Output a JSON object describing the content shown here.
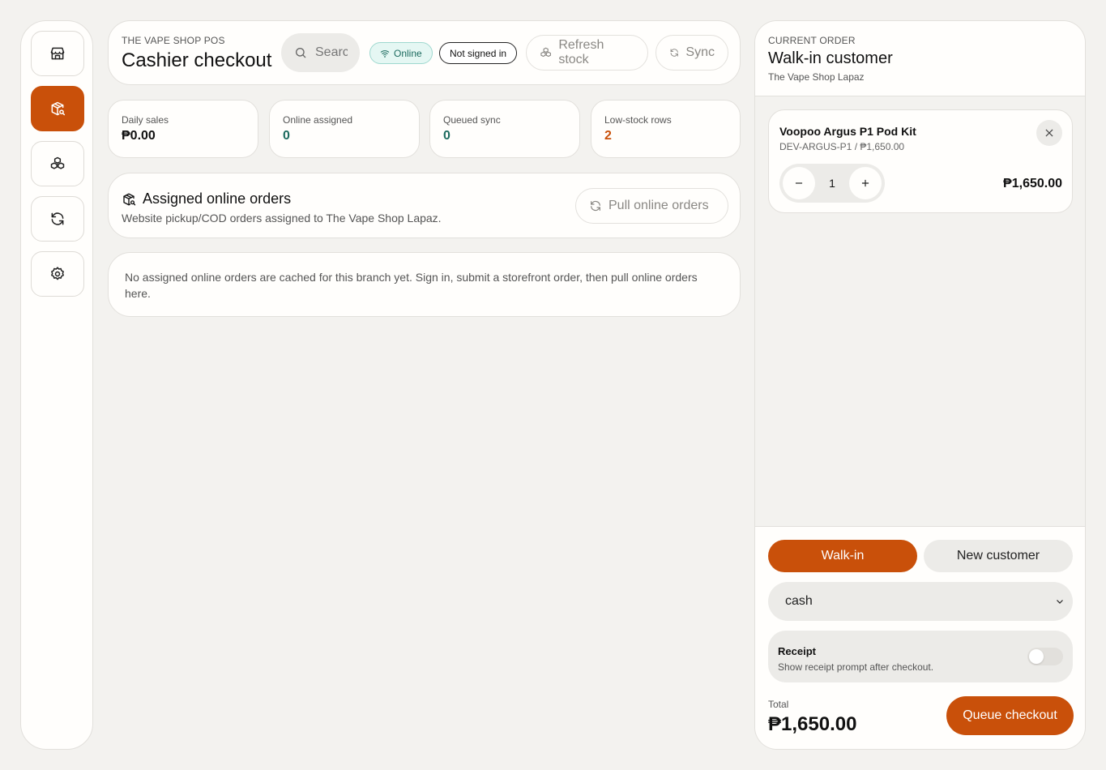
{
  "colors": {
    "accent": "#c9500a",
    "online": "#1d6b5f",
    "background": "#f3f2ef"
  },
  "sidebar": {
    "items": [
      {
        "name": "store",
        "icon": "store-icon",
        "active": false
      },
      {
        "name": "checkout",
        "icon": "package-search-icon",
        "active": true
      },
      {
        "name": "inventory",
        "icon": "boxes-icon",
        "active": false
      },
      {
        "name": "sync",
        "icon": "refresh-icon",
        "active": false
      },
      {
        "name": "settings",
        "icon": "gear-icon",
        "active": false
      }
    ]
  },
  "header": {
    "eyebrow": "THE VAPE SHOP POS",
    "title": "Cashier checkout",
    "search_placeholder": "Search",
    "status_online": "Online",
    "status_auth": "Not signed in",
    "refresh_label": "Refresh stock",
    "sync_label": "Sync"
  },
  "stats": [
    {
      "label": "Daily sales",
      "value": "₱0.00"
    },
    {
      "label": "Online assigned",
      "value": "0"
    },
    {
      "label": "Queued sync",
      "value": "0"
    },
    {
      "label": "Low-stock rows",
      "value": "2"
    }
  ],
  "online_orders": {
    "title": "Assigned online orders",
    "subtitle": "Website pickup/COD orders assigned to The Vape Shop Lapaz.",
    "pull_label": "Pull online orders",
    "empty_message": "No assigned online orders are cached for this branch yet. Sign in, submit a storefront order, then pull online orders here."
  },
  "order": {
    "eyebrow": "CURRENT ORDER",
    "customer": "Walk-in customer",
    "branch": "The Vape Shop Lapaz",
    "items": [
      {
        "name": "Voopoo Argus P1 Pod Kit",
        "sku_price": "DEV-ARGUS-P1 / ₱1,650.00",
        "qty": "1",
        "line_total": "₱1,650.00"
      }
    ],
    "walkin_label": "Walk-in",
    "new_customer_label": "New customer",
    "payment_method": "cash",
    "receipt_title": "Receipt",
    "receipt_desc": "Show receipt prompt after checkout.",
    "receipt_enabled": false,
    "total_label": "Total",
    "total_value": "₱1,650.00",
    "checkout_label": "Queue checkout"
  }
}
